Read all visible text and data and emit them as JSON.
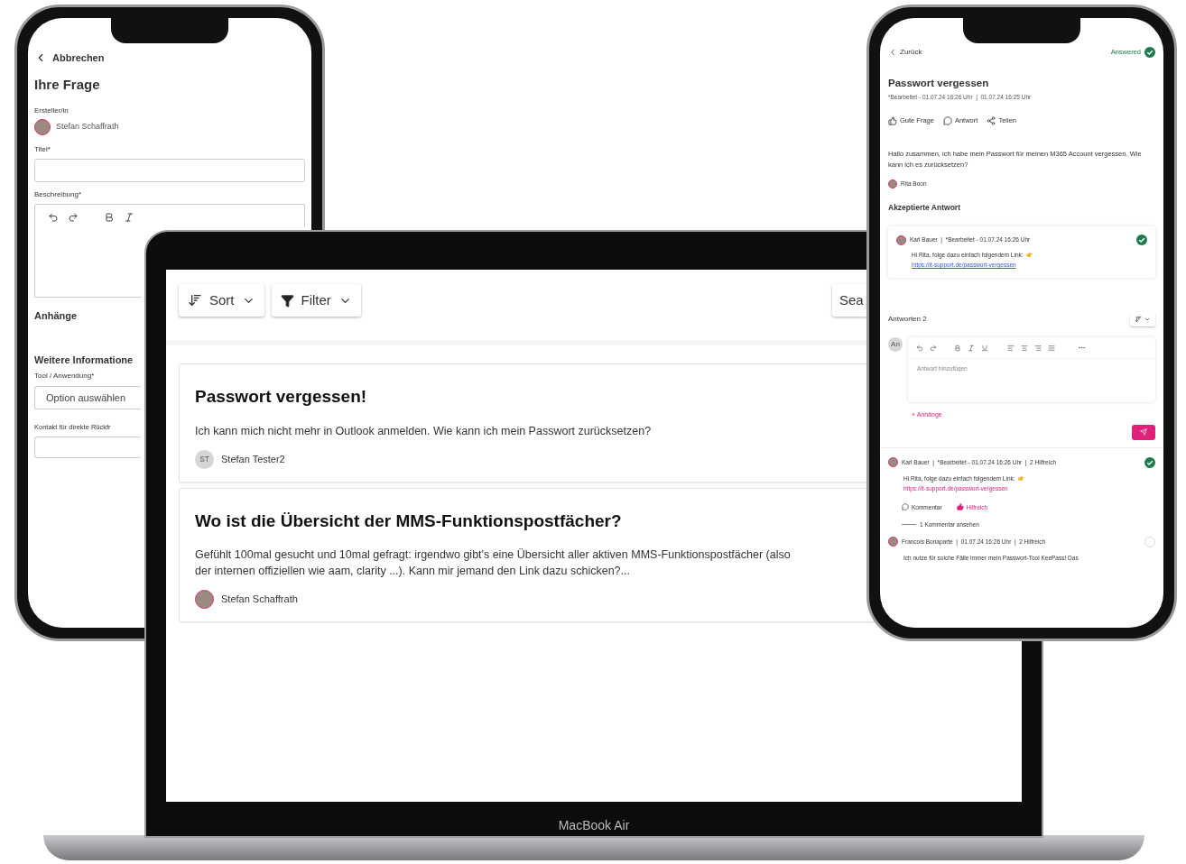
{
  "left_phone": {
    "back": "Abbrechen",
    "title": "Ihre Frage",
    "creator_label": "Ersteller/in",
    "creator": "Stefan Schaffrath",
    "title_label": "Titel*",
    "description_label": "Beschreibung*",
    "attachments_heading": "Anhänge",
    "more_info_heading": "Weitere Informatione",
    "tool_label": "Tool / Anwendung*",
    "tool_select": {
      "placeholder": "Option auswählen"
    },
    "contact_label": "Kontakt für direkte Rückfr"
  },
  "laptop": {
    "toolbar": [
      {
        "kind": "sort",
        "label": "Sort"
      },
      {
        "kind": "filter",
        "label": "Filter"
      }
    ],
    "search": "Sea",
    "posts": [
      {
        "title": "Passwort vergessen!",
        "body": "Ich kann mich nicht mehr in Outlook anmelden. Wie kann ich mein Passwort zurücksetzen?",
        "author": "Stefan Tester2",
        "initials": "ST"
      },
      {
        "title": "Wo ist die Übersicht der MMS-Funktionspostfächer?",
        "body": "Gefühlt 100mal gesucht und 10mal gefragt: irgendwo gibt's eine Übersicht aller aktiven MMS-Funktionspostfächer (also der internen offiziellen wie aam, clarity ...). Kann mir jemand den Link dazu schicken?...",
        "author": "Stefan Schaffrath"
      }
    ],
    "brand": "MacBook Air"
  },
  "right_phone": {
    "back": "Zurück",
    "status": {
      "label": "Answered",
      "answered": true
    },
    "title": "Passwort vergessen",
    "meta": "*Bearbeitet - 01.07.24 16:26 Uhr  |  01.07.24 16:25 Uhr",
    "actions": [
      {
        "kind": "like",
        "label": "Gute Frage"
      },
      {
        "kind": "reply",
        "label": "Antwort"
      },
      {
        "kind": "share",
        "label": "Teilen"
      }
    ],
    "body": "Hallo zusammen, ich habe mein Passwort für meinen M365 Account vergessen. Wie kann ich es zurücksetzen?",
    "author": "Rita Boon",
    "accepted_heading": "Akzeptierte Antwort",
    "accepted": {
      "header": "Karl Bauer  |  *Bearbeitet - 01.07.24 16:26 Uhr",
      "text": "Hi Rita, folge dazu einfach folgendem Link:",
      "link": "https://it-support.de/passwort-vergessen"
    },
    "answers_heading": "Antworten 2",
    "composer": {
      "initials": "An",
      "placeholder": "Antwort hinzufügen",
      "attach": "+ Anhänge"
    },
    "answers": [
      {
        "header": "Karl Bauer  |  *Bearbeitet - 01.07.24 16:26 Uhr  |  2 Hilfreich",
        "accepted": true,
        "text": "Hi Rita, folge dazu einfach folgendem Link:",
        "link": "https://it-support.de/passwort-vergessen",
        "comment": "Kommentar",
        "helpful": {
          "label": "Hilfreich",
          "on": true
        },
        "view_comments": "1 Kommentar ansehen"
      },
      {
        "header": "Francois Bonaparte  |  01.07.24 16:26 Uhr  |  2 Hilfreich",
        "accepted": false,
        "text": "Ich nutze für solche Fälle immer mein Passwort-Tool KeePass! Das"
      }
    ]
  }
}
